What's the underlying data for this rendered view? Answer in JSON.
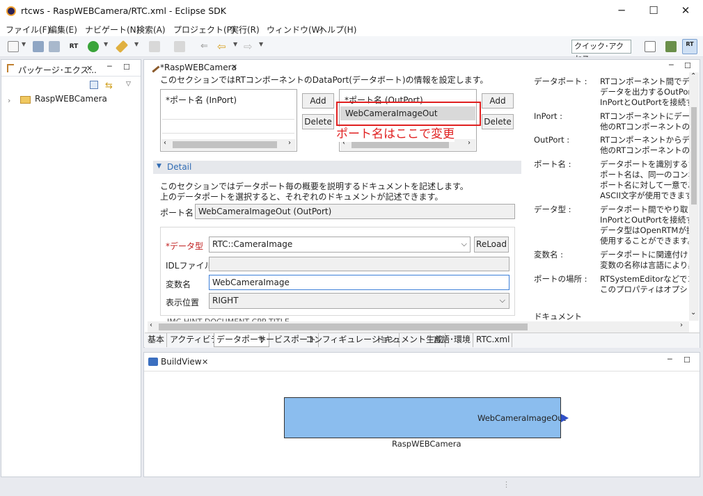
{
  "window": {
    "title": "rtcws - RaspWEBCamera/RTC.xml - Eclipse SDK",
    "minimize": "─",
    "maximize": "☐",
    "close": "✕"
  },
  "menu": [
    "ファイル(F)",
    "編集(E)",
    "ナビゲート(N)",
    "検索(A)",
    "プロジェクト(P)",
    "実行(R)",
    "ウィンドウ(W)",
    "ヘルプ(H)"
  ],
  "toolbar": {
    "quick_access": "クイック･アクセス"
  },
  "explorer": {
    "tab": "パッケージ･エクス...",
    "project": "RaspWEBCamera"
  },
  "editor": {
    "tab": "*RaspWEBCamera",
    "section_desc": "このセクションではRTコンポーネントのDataPort(データポート)の情報を設定します。",
    "inport_header": "*ポート名 (InPort)",
    "outport_header": "*ポート名 (OutPort)",
    "outport_item": "WebCameraImageOut",
    "add": "Add",
    "delete": "Delete",
    "annotation": "ポート名はここで変更",
    "detail_title": "Detail",
    "detail_desc1": "このセクションではデータポート毎の概要を説明するドキュメントを記述します。",
    "detail_desc2": "上のデータポートを選択すると、それぞれのドキュメントが記述できます。",
    "port_name_label": "ポート名 :",
    "port_name_value": "WebCameraImageOut (OutPort)",
    "datatype_label": "*データ型",
    "datatype_value": "RTC::CameraImage",
    "reload": "ReLoad",
    "idl_label": "IDLファイル :",
    "idl_value": "",
    "varname_label": "変数名",
    "varname_value": "WebCameraImage",
    "position_label": "表示位置",
    "position_value": "RIGHT",
    "clipped_text": "IMC HINT DOCUMENT CPP TITLE"
  },
  "help": [
    {
      "term": "データポート :",
      "lines": [
        "RTコンポーネント間でデータを",
        "データを出力するOutPortと",
        "InPortとOutPortを接続す"
      ]
    },
    {
      "term": "InPort :",
      "lines": [
        "RTコンポーネントにデータを入",
        "他のRTコンポーネントのOut"
      ]
    },
    {
      "term": "OutPort :",
      "lines": [
        "RTコンポーネントからデータを",
        "他のRTコンポーネントのInPo"
      ]
    },
    {
      "term": "ポート名 :",
      "lines": [
        "データポートを識別するための",
        "ポート名は、同一のコンポー",
        "ポート名に対して一意である",
        "ASCII文字が使用できます。"
      ]
    },
    {
      "term": "データ型 :",
      "lines": [
        "データポート間でやり取りされ",
        "InPortとOutPortを接続す",
        "データ型はOpenRTMが提供",
        "使用することができます。"
      ]
    },
    {
      "term": "変数名 :",
      "lines": [
        "データポートに関連付けられ",
        "変数の名称は言語により異"
      ]
    },
    {
      "term": "ポートの場所 :",
      "lines": [
        "RTSystemEditorなどでコン",
        "このプロパティはオプショナル"
      ]
    },
    {
      "term": "ドキュメント",
      "lines": []
    }
  ],
  "bottom_tabs": [
    "基本",
    "アクティビティ",
    "データポート",
    "サービスポート",
    "コンフィギュレーション",
    "ドキュメント生成",
    "言語･環境",
    "RTC.xml"
  ],
  "buildview": {
    "tab": "BuildView",
    "component": "RaspWEBCamera",
    "port": "WebCameraImageOut"
  },
  "colors": {
    "annotation": "#e02020",
    "component_fill": "#8bbdee",
    "port": "#3050c8"
  }
}
